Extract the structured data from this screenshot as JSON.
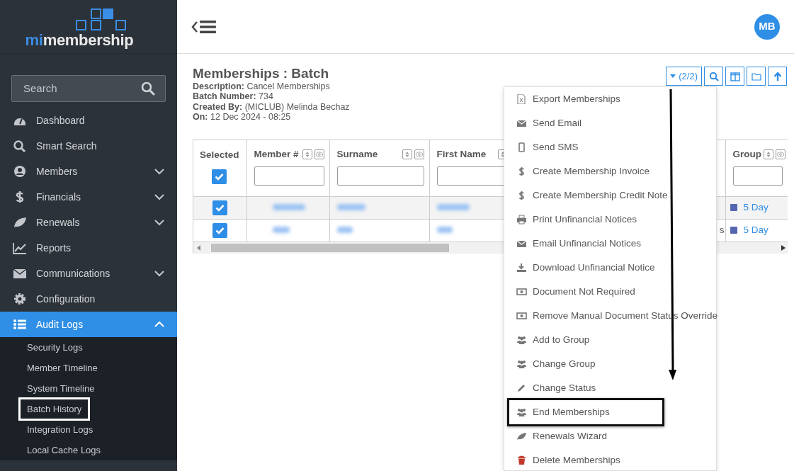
{
  "logo": {
    "prefix": "mi",
    "rest": "membership"
  },
  "sidebar": {
    "search": {
      "placeholder": "Search"
    },
    "items": [
      {
        "label": "Dashboard",
        "selected": false
      },
      {
        "label": "Smart Search",
        "selected": false
      },
      {
        "label": "Members",
        "selected": false,
        "expanded": false
      },
      {
        "label": "Financials",
        "selected": false,
        "expanded": false
      },
      {
        "label": "Renewals",
        "selected": false,
        "expanded": false
      },
      {
        "label": "Reports",
        "selected": false
      },
      {
        "label": "Communications",
        "selected": false,
        "expanded": false
      },
      {
        "label": "Configuration",
        "selected": false
      },
      {
        "label": "Audit Logs",
        "selected": true,
        "expanded": true,
        "children": [
          {
            "label": "Security Logs",
            "highlighted": false
          },
          {
            "label": "Member Timeline",
            "highlighted": false
          },
          {
            "label": "System Timeline",
            "highlighted": false
          },
          {
            "label": "Batch History",
            "highlighted": true
          },
          {
            "label": "Integration Logs",
            "highlighted": false
          },
          {
            "label": "Local Cache Logs",
            "highlighted": false
          }
        ]
      }
    ]
  },
  "header": {
    "avatar": "MB"
  },
  "page": {
    "title": "Memberships : Batch",
    "details": [
      {
        "label": "Description:",
        "value": "Cancel Memberships"
      },
      {
        "label": "Batch Number:",
        "value": "734"
      },
      {
        "label": "Created By:",
        "value": "(MICLUB) Melinda Bechaz"
      },
      {
        "label": "On:",
        "value": "12 Dec 2024 - 08:25"
      }
    ]
  },
  "toolbar": {
    "selection": "(2/2)"
  },
  "table": {
    "select_all": {
      "checked": true
    },
    "columns": [
      {
        "label": "Selected",
        "kind": "select"
      },
      {
        "label": "Member #",
        "kind": "filter"
      },
      {
        "label": "Surname",
        "kind": "filter"
      },
      {
        "label": "First Name",
        "kind": "filter"
      },
      {
        "kind": "hidden"
      },
      {
        "label": "Group",
        "kind": "filter"
      }
    ],
    "rows": [
      {
        "checked": true,
        "group": "5 Day",
        "color": "#5566b0"
      },
      {
        "checked": true,
        "column_5": "s",
        "group": "5 Day",
        "color": "#5566b0"
      }
    ]
  },
  "menu": {
    "items": [
      {
        "label": "Export Memberships",
        "highlighted": false
      },
      {
        "label": "Send Email",
        "highlighted": false
      },
      {
        "label": "Send SMS",
        "highlighted": false
      },
      {
        "label": "Create Membership Invoice",
        "highlighted": false
      },
      {
        "label": "Create Membership Credit Note",
        "highlighted": false
      },
      {
        "label": "Print Unfinancial Notices",
        "highlighted": false
      },
      {
        "label": "Email Unfinancial Notices",
        "highlighted": false
      },
      {
        "label": "Download Unfinancial Notice",
        "highlighted": false
      },
      {
        "label": "Document Not Required",
        "highlighted": false
      },
      {
        "label": "Remove Manual Document Status Override",
        "highlighted": false
      },
      {
        "label": "Add to Group",
        "highlighted": false
      },
      {
        "label": "Change Group",
        "highlighted": false
      },
      {
        "label": "Change Status",
        "highlighted": false
      },
      {
        "label": "End Memberships",
        "highlighted": true
      },
      {
        "label": "Renewals Wizard",
        "highlighted": false
      },
      {
        "label": "Delete Memberships",
        "highlighted": false
      }
    ]
  }
}
